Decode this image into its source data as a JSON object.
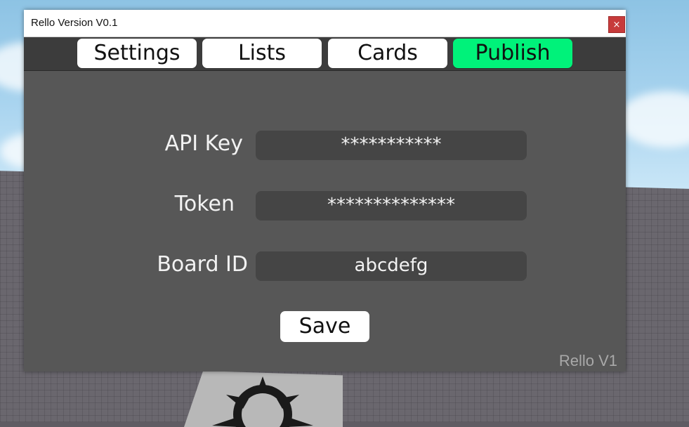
{
  "window": {
    "title": "Rello Version V0.1",
    "close_glyph": "×"
  },
  "tabs": [
    {
      "label": "Settings",
      "active": false
    },
    {
      "label": "Lists",
      "active": false
    },
    {
      "label": "Cards",
      "active": false
    },
    {
      "label": "Publish",
      "active": true
    }
  ],
  "form": {
    "api_key": {
      "label": "API Key",
      "value": "***********"
    },
    "token": {
      "label": "Token",
      "value": "**************"
    },
    "board_id": {
      "label": "Board ID",
      "value": "abcdefg"
    },
    "save_label": "Save"
  },
  "footer": "Rello V1",
  "colors": {
    "active_tab": "#00f27a",
    "panel": "#575757",
    "field": "#454545",
    "close": "#c73b3b"
  }
}
